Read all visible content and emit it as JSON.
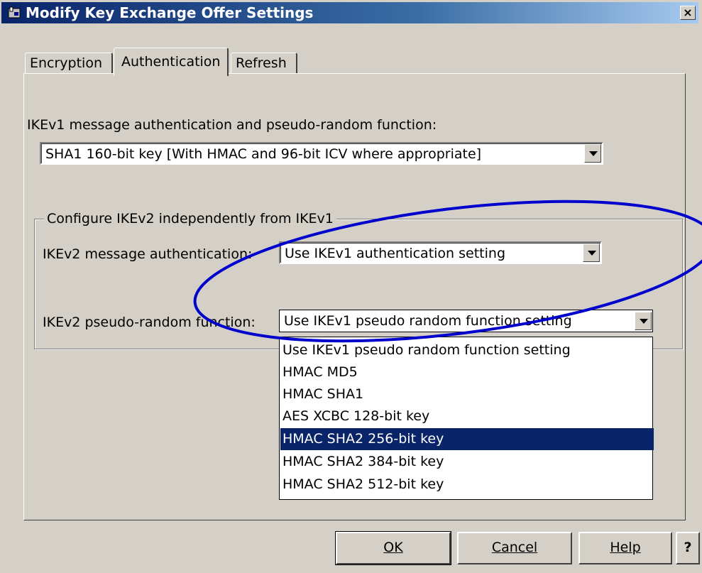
{
  "window": {
    "title": "Modify Key Exchange Offer Settings",
    "close_label": "×"
  },
  "tabs": [
    {
      "label": "Encryption",
      "active": false
    },
    {
      "label": "Authentication",
      "active": true
    },
    {
      "label": "Refresh",
      "active": false
    }
  ],
  "ikev1": {
    "label": "IKEv1 message authentication and pseudo-random function:",
    "value": "SHA1 160-bit key   [With HMAC and 96-bit ICV where appropriate]"
  },
  "ikev2_group": {
    "legend": "Configure IKEv2 independently from IKEv1",
    "auth_label": "IKEv2 message authentication:",
    "auth_value": "Use IKEv1 authentication setting",
    "prf_label": "IKEv2 pseudo-random function:",
    "prf_value": "Use IKEv1 pseudo random function setting"
  },
  "prf_options": [
    "Use IKEv1 pseudo random function setting",
    "HMAC MD5",
    "HMAC SHA1",
    "AES XCBC 128-bit key",
    "HMAC SHA2 256-bit key",
    "HMAC SHA2 384-bit key",
    "HMAC SHA2 512-bit key"
  ],
  "prf_highlighted": "HMAC SHA2 256-bit key",
  "buttons": {
    "ok": "OK",
    "cancel": "Cancel",
    "help": "Help",
    "question": "?"
  },
  "colors": {
    "titlebar": "#0a246a",
    "selection": "#0a246a",
    "annotation": "#0000cc"
  }
}
